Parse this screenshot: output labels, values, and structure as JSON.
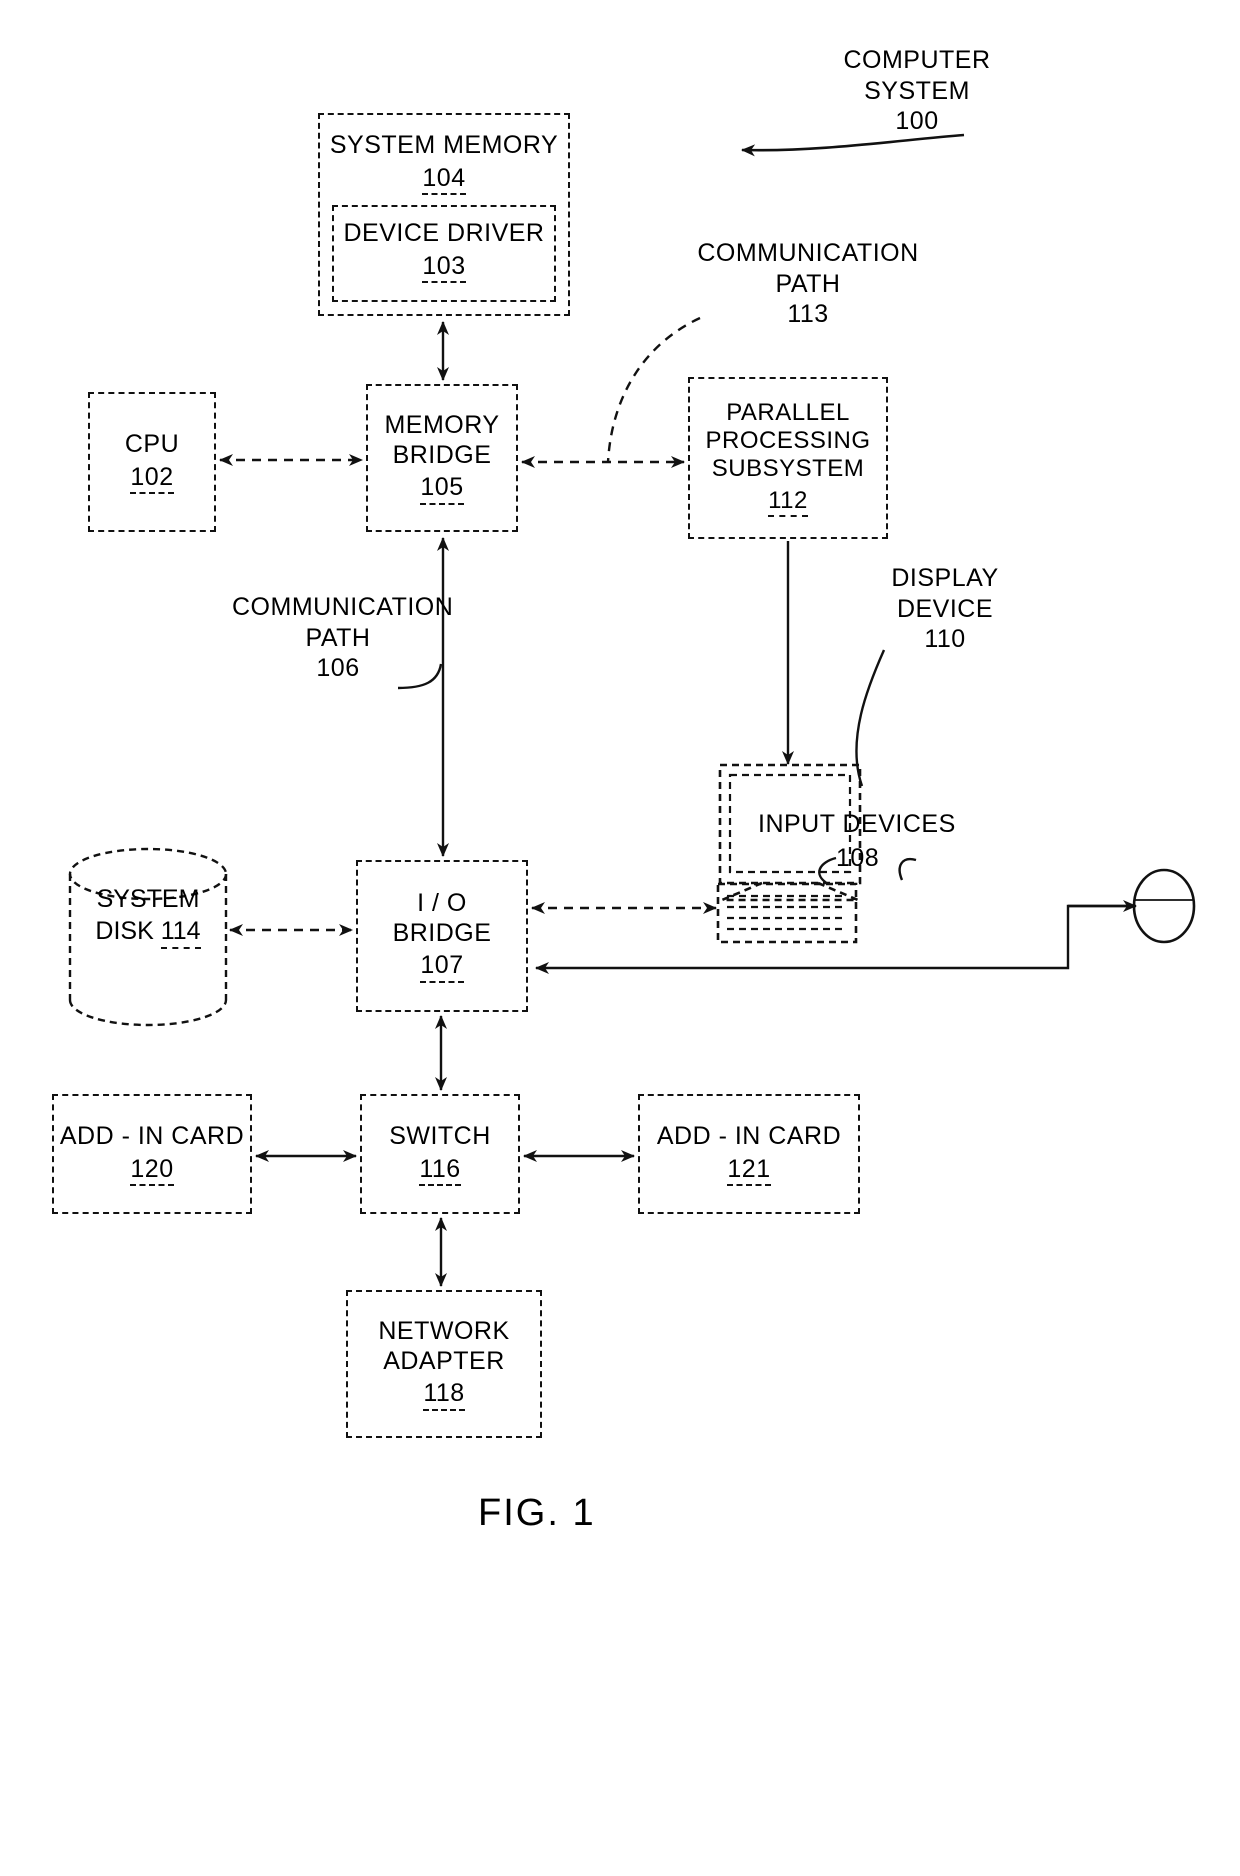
{
  "figure": {
    "caption": "FIG. 1",
    "title": "COMPUTER SYSTEM 100",
    "line_color": "#111111",
    "background": "#ffffff"
  },
  "blocks": {
    "system_memory": {
      "name": "SYSTEM MEMORY",
      "ref": "104"
    },
    "device_driver": {
      "name": "DEVICE DRIVER",
      "ref": "103"
    },
    "cpu": {
      "name": "CPU",
      "ref": "102"
    },
    "memory_bridge": {
      "line1": "MEMORY",
      "line2": "BRIDGE",
      "ref": "105"
    },
    "parallel_processing_subsystem": {
      "line1": "PARALLEL",
      "line2": "PROCESSING",
      "line3": "SUBSYSTEM",
      "ref": "112"
    },
    "io_bridge": {
      "line1": "I / O",
      "line2": "BRIDGE",
      "ref": "107"
    },
    "system_disk": {
      "line1": "SYSTEM",
      "line2": "DISK",
      "ref": "114"
    },
    "switch": {
      "name": "SWITCH",
      "ref": "116"
    },
    "add_in_card_120": {
      "name": "ADD - IN CARD",
      "ref": "120"
    },
    "add_in_card_121": {
      "name": "ADD - IN CARD",
      "ref": "121"
    },
    "network_adapter": {
      "line1": "NETWORK",
      "line2": "ADAPTER",
      "ref": "118"
    }
  },
  "annotations": {
    "computer_system": {
      "line1": "COMPUTER",
      "line2": "SYSTEM",
      "ref": "100"
    },
    "communication_path_113": {
      "line1": "COMMUNICATION",
      "line2": "PATH",
      "ref": "113"
    },
    "communication_path_106": {
      "line1": "COMMUNICATION",
      "line2": "PATH",
      "ref": "106"
    },
    "display_device": {
      "line1": "DISPLAY",
      "line2": "DEVICE",
      "ref": "110"
    },
    "input_devices": {
      "label": "INPUT  DEVICES",
      "ref": "108"
    }
  },
  "icons": {
    "display_device": "monitor-icon",
    "keyboard": "keyboard-icon",
    "mouse": "mouse-icon",
    "system_disk": "cylinder-disk-icon"
  },
  "connections": [
    {
      "id": "sysmem-membridge",
      "from": "system_memory",
      "to": "memory_bridge",
      "style": "solid",
      "arrows": "both",
      "orientation": "vertical"
    },
    {
      "id": "cpu-membridge",
      "from": "cpu",
      "to": "memory_bridge",
      "style": "dashed",
      "arrows": "both",
      "orientation": "horizontal"
    },
    {
      "id": "membridge-pps",
      "from": "memory_bridge",
      "to": "parallel_processing_subsystem",
      "style": "dashed",
      "arrows": "both",
      "orientation": "horizontal",
      "label_ref": "113"
    },
    {
      "id": "membridge-iobridge",
      "from": "memory_bridge",
      "to": "io_bridge",
      "style": "solid",
      "arrows": "both",
      "orientation": "vertical",
      "label_ref": "106"
    },
    {
      "id": "pps-display",
      "from": "parallel_processing_subsystem",
      "to": "display_device",
      "style": "solid",
      "arrows": "end",
      "orientation": "vertical"
    },
    {
      "id": "disk-iobridge",
      "from": "system_disk",
      "to": "io_bridge",
      "style": "dashed",
      "arrows": "both",
      "orientation": "horizontal"
    },
    {
      "id": "iobridge-keyboard",
      "from": "io_bridge",
      "to": "keyboard",
      "style": "dashed",
      "arrows": "both",
      "orientation": "horizontal"
    },
    {
      "id": "iobridge-mouse",
      "from": "io_bridge",
      "to": "mouse",
      "style": "solid",
      "arrows": "both",
      "orientation": "routed"
    },
    {
      "id": "iobridge-switch",
      "from": "io_bridge",
      "to": "switch",
      "style": "solid",
      "arrows": "both",
      "orientation": "vertical"
    },
    {
      "id": "switch-addin120",
      "from": "switch",
      "to": "add_in_card_120",
      "style": "solid",
      "arrows": "both",
      "orientation": "horizontal"
    },
    {
      "id": "switch-addin121",
      "from": "switch",
      "to": "add_in_card_121",
      "style": "solid",
      "arrows": "both",
      "orientation": "horizontal"
    },
    {
      "id": "switch-network",
      "from": "switch",
      "to": "network_adapter",
      "style": "solid",
      "arrows": "both",
      "orientation": "vertical"
    }
  ]
}
